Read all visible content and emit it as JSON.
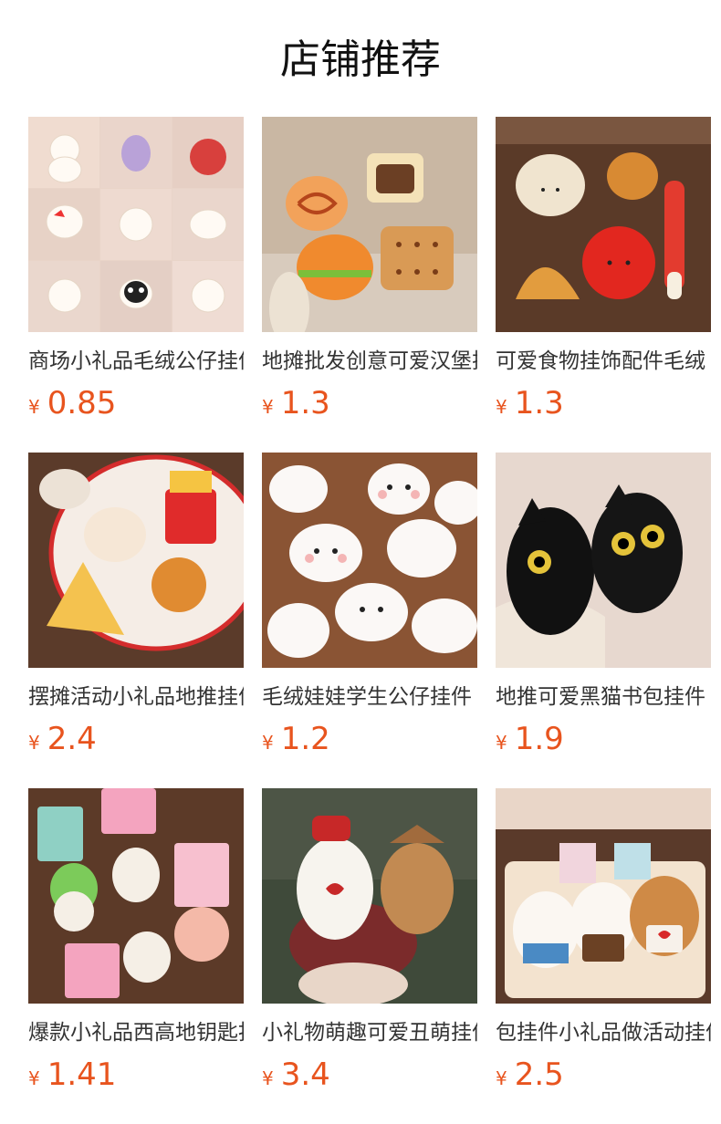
{
  "header": {
    "title": "店铺推荐"
  },
  "currency_symbol": "¥",
  "colors": {
    "price": "#e8541e",
    "title": "#111111",
    "text": "#333333"
  },
  "products": [
    {
      "name": "商场小礼品毛绒公仔挂件",
      "price": "0.85",
      "icon": "plush-keychain-grid-image"
    },
    {
      "name": "地摊批发创意可爱汉堡挂件",
      "price": "1.3",
      "icon": "food-plush-image"
    },
    {
      "name": "可爱食物挂饰配件毛绒",
      "price": "1.3",
      "icon": "food-charm-image"
    },
    {
      "name": "摆摊活动小礼品地推挂件",
      "price": "2.4",
      "icon": "fries-plush-image"
    },
    {
      "name": "毛绒娃娃学生公仔挂件",
      "price": "1.2",
      "icon": "cloud-plush-image"
    },
    {
      "name": "地推可爱黑猫书包挂件",
      "price": "1.9",
      "icon": "black-cat-plush-image"
    },
    {
      "name": "爆款小礼品西高地钥匙扣",
      "price": "1.41",
      "icon": "westie-plush-image"
    },
    {
      "name": "小礼物萌趣可爱丑萌挂件",
      "price": "3.4",
      "icon": "bear-scrunchie-image"
    },
    {
      "name": "包挂件小礼品做活动挂件",
      "price": "2.5",
      "icon": "dog-plush-image"
    }
  ]
}
